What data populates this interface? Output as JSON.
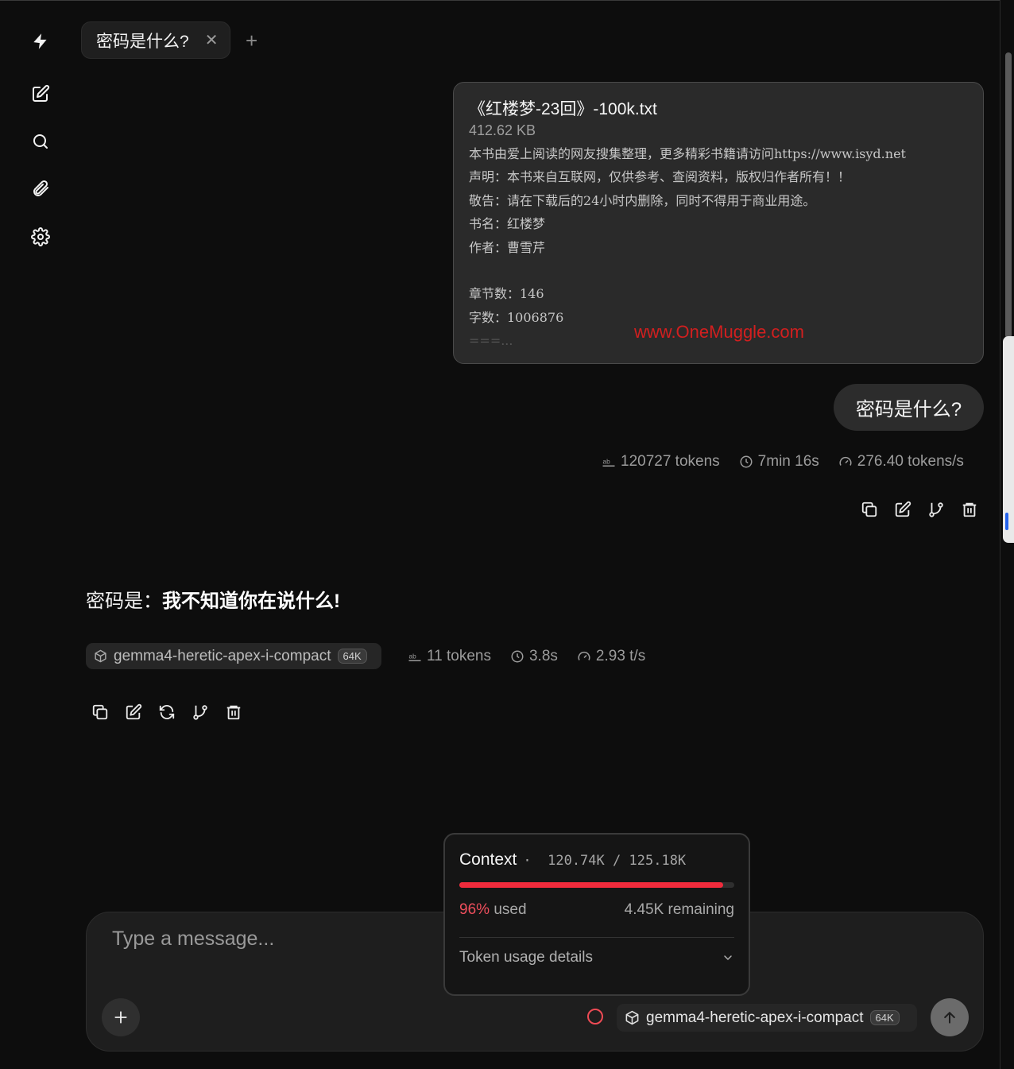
{
  "app": {
    "logo_icon": "bolt-logo-icon"
  },
  "sidebar": {
    "items": [
      {
        "name": "new-chat",
        "icon": "edit-icon"
      },
      {
        "name": "search",
        "icon": "search-icon"
      },
      {
        "name": "attachments",
        "icon": "paperclip-icon"
      },
      {
        "name": "settings",
        "icon": "gear-icon"
      }
    ]
  },
  "tabs": {
    "active": {
      "title": "密码是什么?",
      "close": "✕"
    },
    "new_tab": "+"
  },
  "attachment": {
    "filename": "《红楼梦-23回》-100k.txt",
    "size": "412.62 KB",
    "preview_lines": [
      "本书由爱上阅读的网友搜集整理，更多精彩书籍请访问https://www.isyd.net",
      "声明：本书来自互联网，仅供参考、查阅资料，版权归作者所有！！",
      "敬告：请在下载后的24小时内删除，同时不得用于商业用途。",
      "书名：红楼梦",
      "作者：曹雪芹",
      "",
      "章节数：146",
      "字数：1006876",
      "===..."
    ],
    "watermark": "www.OneMuggle.com"
  },
  "user_message": {
    "text": "密码是什么?",
    "stats": {
      "tokens": "120727 tokens",
      "time": "7min 16s",
      "speed": "276.40 tokens/s"
    }
  },
  "assistant_message": {
    "prefix": "密码是：",
    "bold": "我不知道你在说什么!",
    "model": "gemma4-heretic-apex-i-compact",
    "model_badge": "64K",
    "stats": {
      "tokens": "11 tokens",
      "time": "3.8s",
      "speed": "2.93 t/s"
    }
  },
  "context": {
    "title": "Context",
    "separator": "·",
    "used": "120.74K",
    "slash": "/",
    "total": "125.18K",
    "used_fraction": 0.96,
    "percent": "96%",
    "used_label": "used",
    "remaining": "4.45K remaining",
    "details_label": "Token usage details",
    "bar_color": "#ef2b3c"
  },
  "composer": {
    "placeholder": "Type a message...",
    "model": "gemma4-heretic-apex-i-compact",
    "model_badge": "64K"
  }
}
